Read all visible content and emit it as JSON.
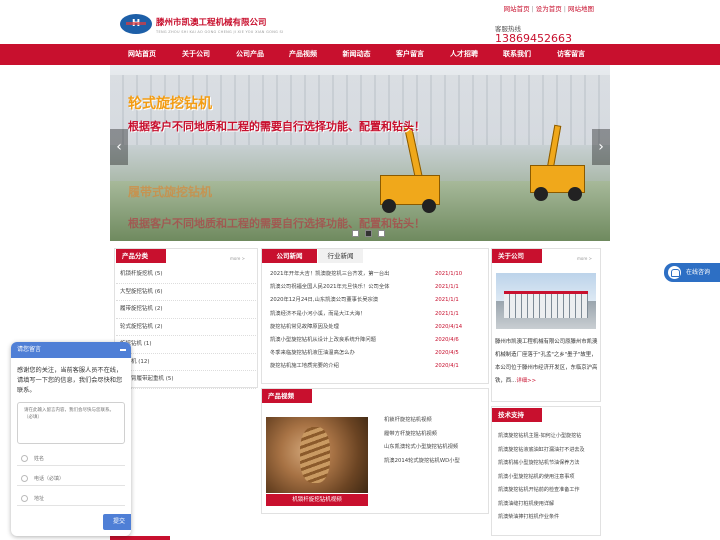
{
  "top_links": [
    "网站首页",
    "设为首页",
    "网站地图"
  ],
  "header": {
    "logo_text": "H",
    "company_name": "滕州市凯澳工程机械有限公司",
    "company_en": "TENG ZHOU SHI KAI AO GONG CHENG JI XIE YOU XIAN GONG SI",
    "hotline_label": "客服热线",
    "hotline": "13869452663"
  },
  "nav": [
    "网站首页",
    "关于公司",
    "公司产品",
    "产品视频",
    "新闻动态",
    "客户留言",
    "人才招聘",
    "联系我们",
    "访客留言"
  ],
  "banner": {
    "line1": "轮式旋挖钻机",
    "line2": "根据客户不同地质和工程的需要自行选择功能、配置和钻头！",
    "line3": "履带式旋挖钻机",
    "line4": "根据客户不同地质和工程的需要自行选择功能、配置和钻头！",
    "prev": "‹",
    "next": "›"
  },
  "categories": {
    "title": "产品分类",
    "more": "more >",
    "items": [
      "机锁杆旋挖机 (5)",
      "大型旋挖钻机 (6)",
      "履带旋挖钻机 (2)",
      "轮式旋挖钻机 (2)",
      "旋挖钻机 (1)",
      "挖钻机 (12)",
      "旋挖臂履带起重机 (5)"
    ]
  },
  "news": {
    "tab_active": "公司新闻",
    "tab_inactive": "行业新闻",
    "items": [
      {
        "title": "2021年开年大吉！凯澳旋挖机三台齐发，第一台出",
        "date": "2021/1/10"
      },
      {
        "title": "凯澳公司祝福全国人民2021年元旦快乐！公司全体",
        "date": "2021/1/1"
      },
      {
        "title": "2020年12月24日,山东凯澳公司董事长吴宗澳",
        "date": "2021/1/1"
      },
      {
        "title": "凯澳经济不是小河小溪，而是大江大海！",
        "date": "2021/1/1"
      },
      {
        "title": "旋挖钻机常见故障原因及处理",
        "date": "2020/4/14"
      },
      {
        "title": "凯澳小型旋挖钻机从设计上改良系统升降问题",
        "date": "2020/4/6"
      },
      {
        "title": "冬季来临旋挖钻机液压油温高怎么办",
        "date": "2020/4/5"
      },
      {
        "title": "旋挖钻机施工地质完要的介绍",
        "date": "2020/4/1"
      }
    ]
  },
  "videos": {
    "title": "产品视频",
    "featured_caption": "机锁杆旋挖钻机视频",
    "items": [
      "机锁杆旋挖钻机视频",
      "履带方杆旋挖钻机视频",
      "山东凯澳轮式小型旋挖钻机视频",
      "凯澳2014轮式旋挖钻机WD小型"
    ]
  },
  "about": {
    "title": "关于公司",
    "more": "more >",
    "text": "滕州市凯澳工程机械有限公司原滕州市凯澳机械制造厂座落于\"孔孟\"之乡\"墨子\"故里，本公司位于滕州市经济开发区，东临京沪高铁，西...",
    "detail_link": "详细>>"
  },
  "tech": {
    "title": "技术支持",
    "items": [
      "凯澳旋挖钻机主阻-如何让小型旋挖钻",
      "凯澳旋挖钻液底油缸打漏油打不进去及",
      "凯澳机械小型旋挖钻机节油保养方法",
      "凯澳小型旋挖钻机的使用注意事项",
      "凯澳旋挖钻机开钻前的检查准备工作",
      "凯澳油缝打桩机使用详解",
      "凯澳柴油捧打桩机作业条件"
    ]
  },
  "online_service": "在线咨询",
  "chat": {
    "title": "请您留言",
    "message": "感谢您的关注，当前客服人员不在线，请填写一下您的信息，我们会尽快和您联系。",
    "textarea_placeholder": "请在此输入留言内容，我们会尽快与您联系。（必填）",
    "name_placeholder": "姓名",
    "phone_placeholder": "电话（必填）",
    "address_placeholder": "地址",
    "submit": "提交"
  },
  "colors": {
    "brand_red": "#c8102e",
    "chat_blue": "#4f7fd6",
    "online_blue": "#2d6fc4"
  }
}
